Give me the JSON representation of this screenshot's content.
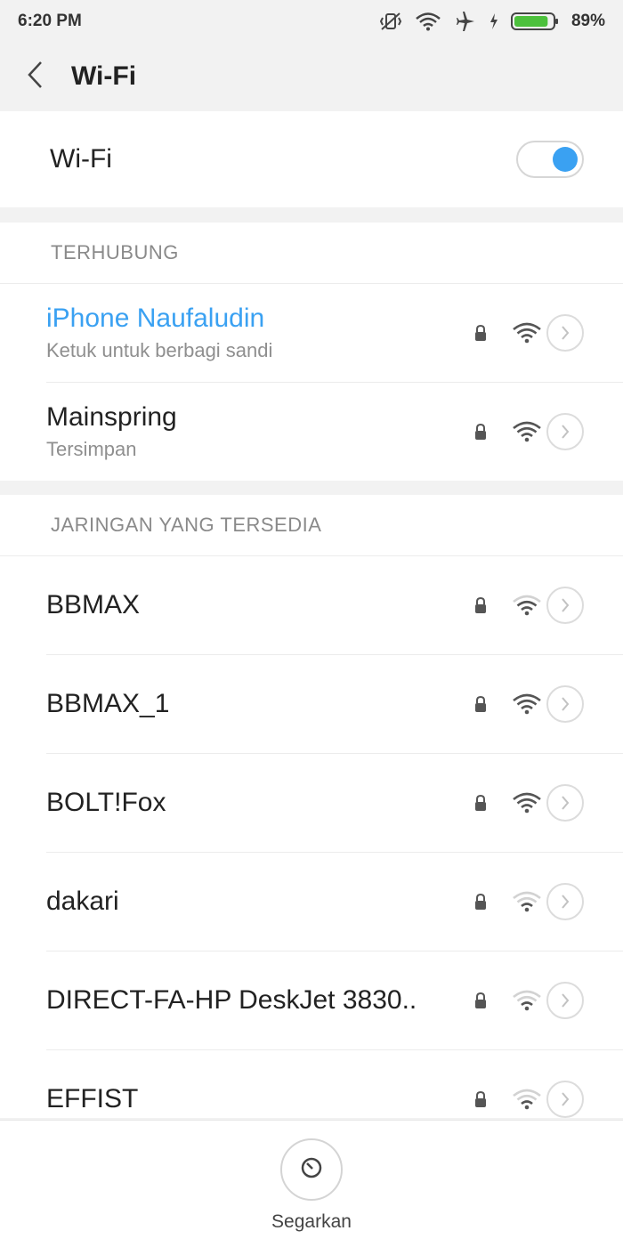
{
  "status_bar": {
    "time": "6:20 PM",
    "battery_percent": "89%",
    "icons": [
      "vibrate-off-icon",
      "wifi-icon",
      "airplane-icon",
      "charging-icon",
      "battery-icon"
    ],
    "battery_level": 0.89
  },
  "header": {
    "title": "Wi-Fi",
    "back_icon": "chevron-left-icon"
  },
  "wifi_toggle": {
    "label": "Wi-Fi",
    "enabled": true
  },
  "connected_section": {
    "header": "TERHUBUNG",
    "networks": [
      {
        "name": "iPhone Naufaludin",
        "subtitle": "Ketuk untuk berbagi sandi",
        "secured": true,
        "signal": 4,
        "connected": true
      },
      {
        "name": "Mainspring",
        "subtitle": "Tersimpan",
        "secured": true,
        "signal": 4,
        "connected": false
      }
    ]
  },
  "available_section": {
    "header": "JARINGAN YANG TERSEDIA",
    "networks": [
      {
        "name": "BBMAX",
        "secured": true,
        "signal": 3
      },
      {
        "name": "BBMAX_1",
        "secured": true,
        "signal": 4
      },
      {
        "name": "BOLT!Fox",
        "secured": true,
        "signal": 4
      },
      {
        "name": "dakari",
        "secured": true,
        "signal": 2
      },
      {
        "name": "DIRECT-FA-HP DeskJet 3830..",
        "secured": true,
        "signal": 2
      },
      {
        "name": "EFFIST",
        "secured": true,
        "signal": 2
      }
    ]
  },
  "bottom_bar": {
    "refresh_label": "Segarkan",
    "refresh_icon": "refresh-icon"
  },
  "colors": {
    "accent": "#3aa1f2",
    "background": "#f2f2f2",
    "card": "#ffffff",
    "secondary_text": "#8f8f8f"
  }
}
